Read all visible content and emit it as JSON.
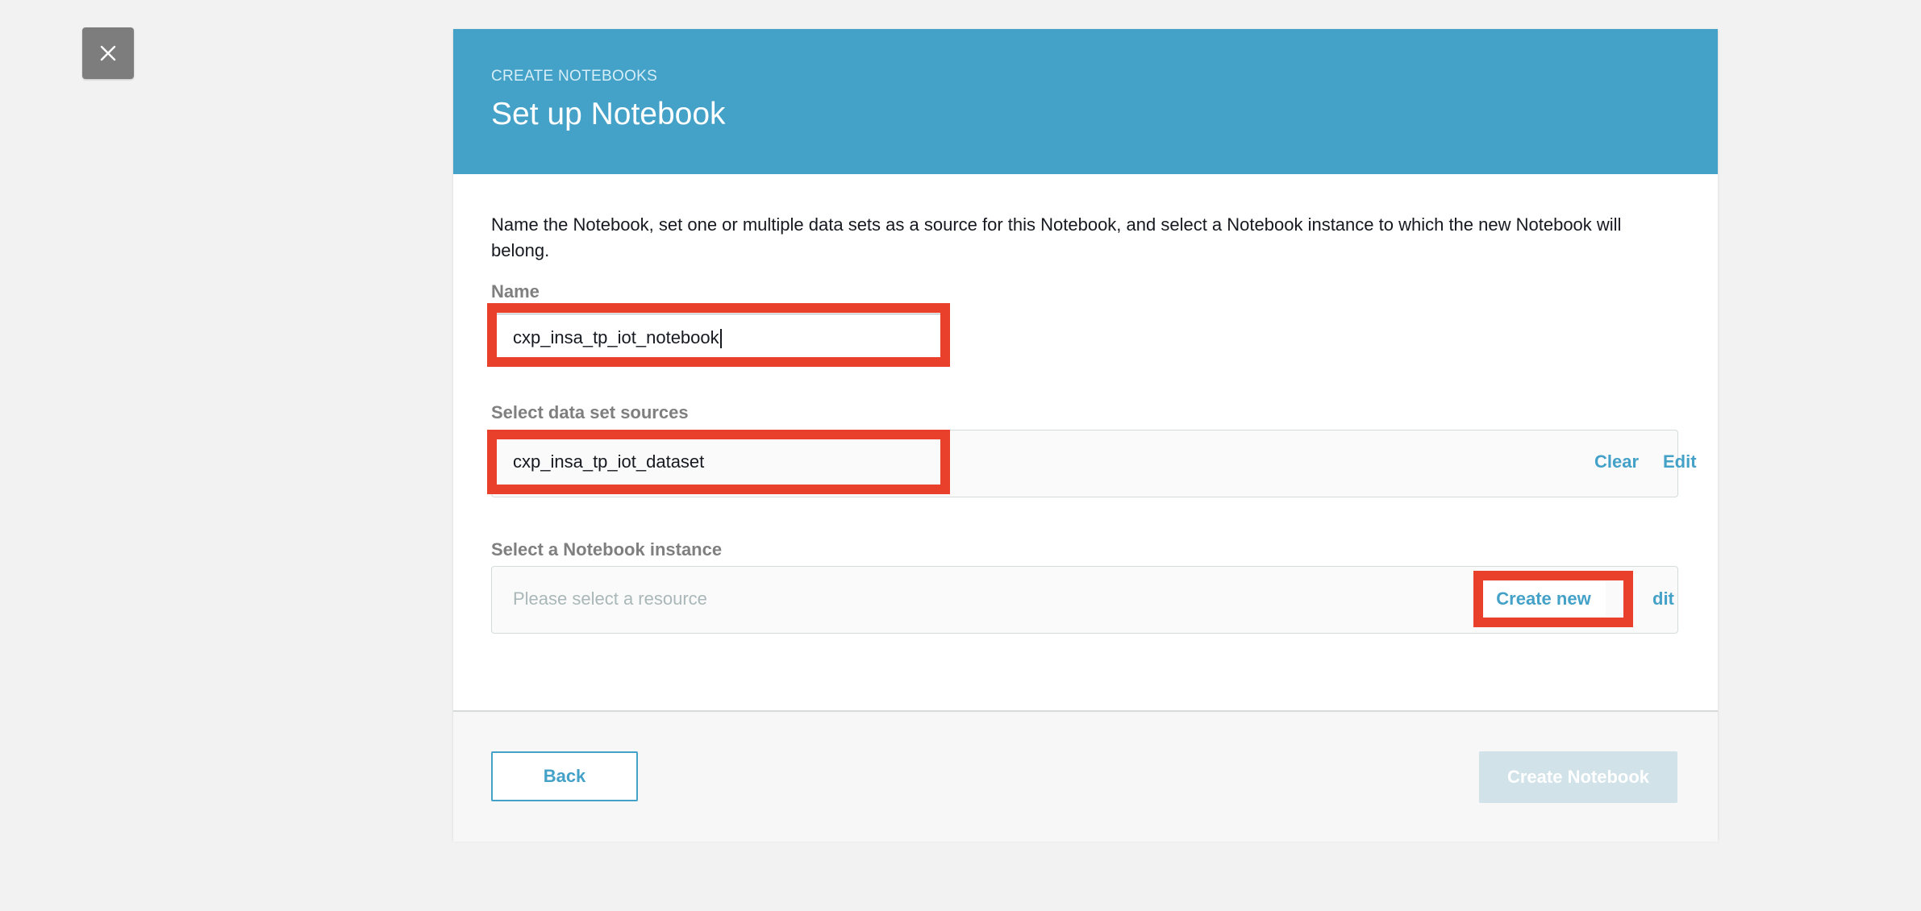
{
  "close": {
    "icon": "close-icon"
  },
  "header": {
    "breadcrumb": "CREATE NOTEBOOKS",
    "title": "Set up Notebook"
  },
  "description": "Name the Notebook, set one or multiple data sets as a source for this Notebook, and select a Notebook instance to which the new Notebook will belong.",
  "name_field": {
    "label": "Name",
    "value": "cxp_insa_tp_iot_notebook"
  },
  "dataset_field": {
    "label": "Select data set sources",
    "value": "cxp_insa_tp_iot_dataset",
    "clear_label": "Clear",
    "edit_label": "Edit"
  },
  "instance_field": {
    "label": "Select a Notebook instance",
    "placeholder": "Please select a resource",
    "create_new_label": "Create new",
    "edit_label": "Edit",
    "edit_visible": "dit"
  },
  "footer": {
    "back_label": "Back",
    "create_label": "Create Notebook"
  },
  "colors": {
    "header_bg": "#44a1c8",
    "link": "#44a1c8",
    "highlight": "#e8402a",
    "disabled_button": "#d1e2e8",
    "page_bg": "#f2f2f2"
  }
}
